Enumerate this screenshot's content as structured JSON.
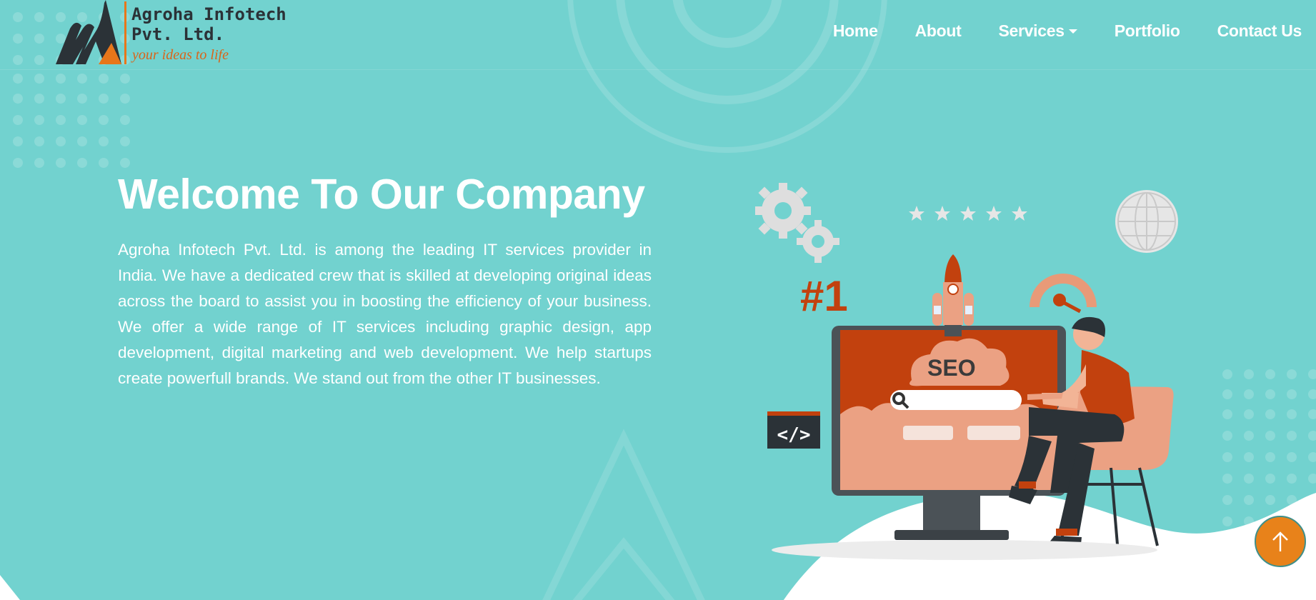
{
  "brand": {
    "name": "Agroha Infotech\nPvt. Ltd.",
    "tagline": "your ideas to life"
  },
  "nav": {
    "items": [
      {
        "label": "Home"
      },
      {
        "label": "About"
      },
      {
        "label": "Services",
        "has_dropdown": true
      },
      {
        "label": "Portfolio"
      },
      {
        "label": "Contact Us"
      }
    ]
  },
  "hero": {
    "title": "Welcome To Our Company",
    "description": "Agroha Infotech Pvt. Ltd. is among the leading IT services provider in India. We have a dedicated crew that is skilled at developing original ideas across the board to assist you in boosting the efficiency of your business. We offer a wide range of IT services including graphic design, app development, digital marketing and web development. We help startups create powerfull brands. We stand out from the other IT businesses."
  },
  "illustration": {
    "rank_label": "#1",
    "screen_label": "SEO",
    "code_label": "</>",
    "rating_stars": 5
  },
  "scroll_top": {
    "icon": "arrow-up-icon"
  },
  "colors": {
    "background": "#72d2cf",
    "accent_orange": "#e8821a",
    "illustration_red": "#c2410e",
    "logo_dark": "#2b3237"
  }
}
